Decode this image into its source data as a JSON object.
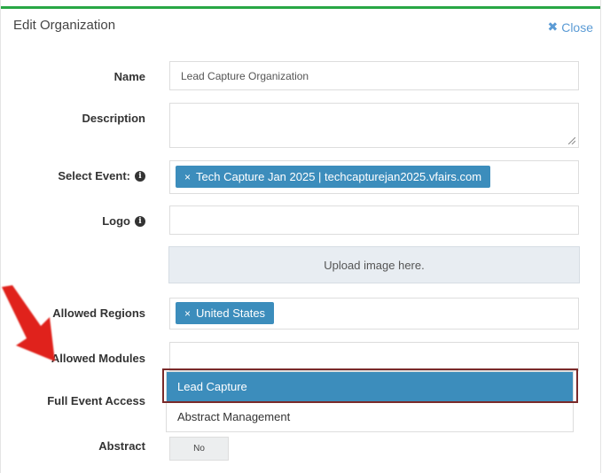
{
  "modal": {
    "title": "Edit Organization",
    "close_label": "Close"
  },
  "form": {
    "name": {
      "label": "Name",
      "value": "Lead Capture Organization"
    },
    "description": {
      "label": "Description",
      "value": ""
    },
    "select_event": {
      "label": "Select Event:",
      "tags": [
        "Tech Capture Jan 2025 | techcapturejan2025.vfairs.com"
      ]
    },
    "logo": {
      "label": "Logo",
      "value": ""
    },
    "upload": {
      "text": "Upload image here."
    },
    "allowed_regions": {
      "label": "Allowed Regions",
      "tags": [
        "United States"
      ]
    },
    "allowed_modules": {
      "label": "Allowed Modules",
      "options": [
        "Lead Capture",
        "Abstract Management"
      ],
      "highlighted": "Lead Capture"
    },
    "full_event_access": {
      "label": "Full Event Access"
    },
    "abstract": {
      "label": "Abstract",
      "toggle_value": "No"
    }
  },
  "colors": {
    "accent": "#28a745",
    "tag_bg": "#3c8dbc",
    "arrow": "#e0231b"
  },
  "icons": {
    "close": "x-icon",
    "info": "info-circle-icon",
    "tag_remove": "x-icon",
    "annotation": "arrow-icon"
  }
}
